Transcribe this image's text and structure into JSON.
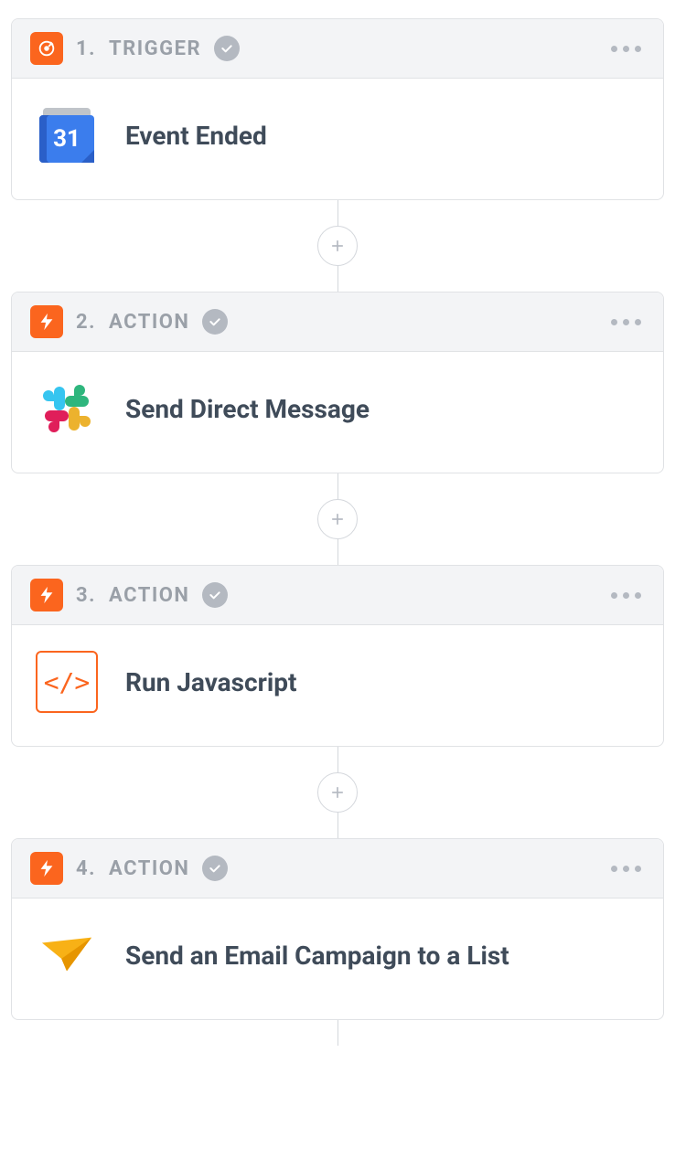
{
  "steps": {
    "s0": {
      "number": "1.",
      "type": "TRIGGER",
      "title": "Event Ended",
      "calendarDay": "31"
    },
    "s1": {
      "number": "2.",
      "type": "ACTION",
      "title": "Send Direct Message"
    },
    "s2": {
      "number": "3.",
      "type": "ACTION",
      "title": "Run Javascript",
      "codeGlyph": "</>"
    },
    "s3": {
      "number": "4.",
      "type": "ACTION",
      "title": "Send an Email Campaign to a List"
    }
  }
}
